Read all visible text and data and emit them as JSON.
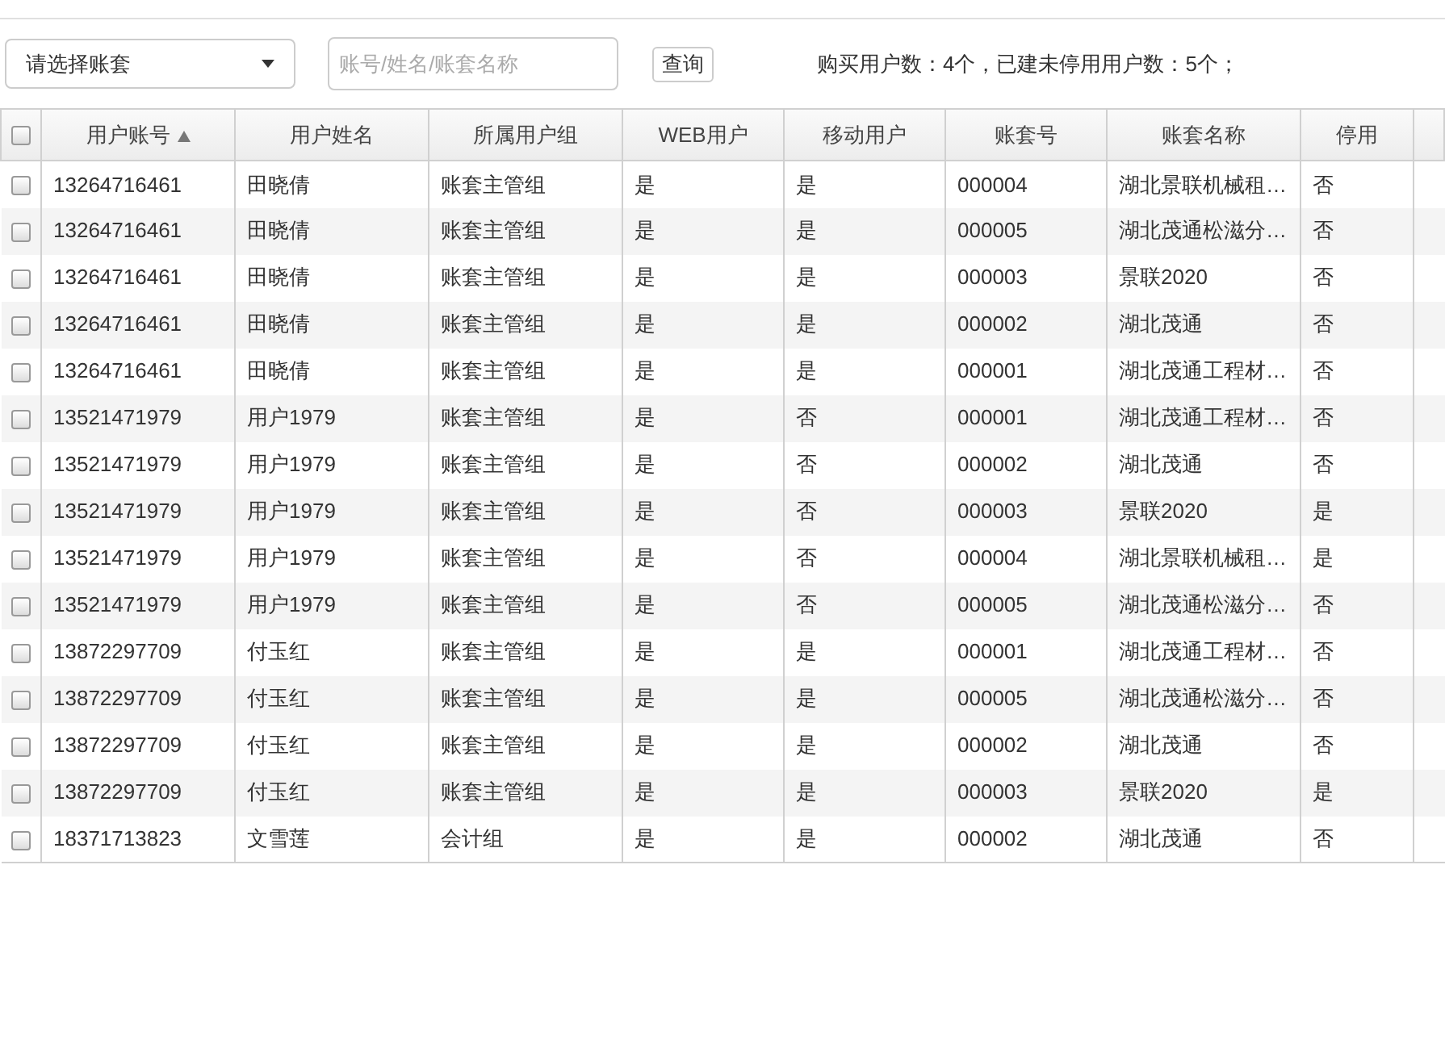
{
  "toolbar": {
    "account_select": {
      "value": "请选择账套"
    },
    "search": {
      "placeholder": "账号/姓名/账套名称"
    },
    "query_button": "查询",
    "summary": "购买用户数：4个，已建未停用用户数：5个；"
  },
  "table": {
    "select_all": {
      "checked": false
    },
    "columns": [
      {
        "label": "用户账号",
        "sorted": true
      },
      {
        "label": "用户姓名",
        "sorted": false
      },
      {
        "label": "所属用户组",
        "sorted": false
      },
      {
        "label": "WEB用户",
        "sorted": false
      },
      {
        "label": "移动用户",
        "sorted": false
      },
      {
        "label": "账套号",
        "sorted": false
      },
      {
        "label": "账套名称",
        "sorted": false
      },
      {
        "label": "停用",
        "sorted": false
      }
    ],
    "rows": [
      {
        "checked": false,
        "cells": [
          "13264716461",
          "田晓倩",
          "账套主管组",
          "是",
          "是",
          "000004",
          "湖北景联机械租…",
          "否"
        ]
      },
      {
        "checked": false,
        "cells": [
          "13264716461",
          "田晓倩",
          "账套主管组",
          "是",
          "是",
          "000005",
          "湖北茂通松滋分…",
          "否"
        ]
      },
      {
        "checked": false,
        "cells": [
          "13264716461",
          "田晓倩",
          "账套主管组",
          "是",
          "是",
          "000003",
          "景联2020",
          "否"
        ]
      },
      {
        "checked": false,
        "cells": [
          "13264716461",
          "田晓倩",
          "账套主管组",
          "是",
          "是",
          "000002",
          "湖北茂通",
          "否"
        ]
      },
      {
        "checked": false,
        "cells": [
          "13264716461",
          "田晓倩",
          "账套主管组",
          "是",
          "是",
          "000001",
          "湖北茂通工程材…",
          "否"
        ]
      },
      {
        "checked": false,
        "cells": [
          "13521471979",
          "用户1979",
          "账套主管组",
          "是",
          "否",
          "000001",
          "湖北茂通工程材…",
          "否"
        ]
      },
      {
        "checked": false,
        "cells": [
          "13521471979",
          "用户1979",
          "账套主管组",
          "是",
          "否",
          "000002",
          "湖北茂通",
          "否"
        ]
      },
      {
        "checked": false,
        "cells": [
          "13521471979",
          "用户1979",
          "账套主管组",
          "是",
          "否",
          "000003",
          "景联2020",
          "是"
        ]
      },
      {
        "checked": false,
        "cells": [
          "13521471979",
          "用户1979",
          "账套主管组",
          "是",
          "否",
          "000004",
          "湖北景联机械租…",
          "是"
        ]
      },
      {
        "checked": false,
        "cells": [
          "13521471979",
          "用户1979",
          "账套主管组",
          "是",
          "否",
          "000005",
          "湖北茂通松滋分…",
          "否"
        ]
      },
      {
        "checked": false,
        "cells": [
          "13872297709",
          "付玉红",
          "账套主管组",
          "是",
          "是",
          "000001",
          "湖北茂通工程材…",
          "否"
        ]
      },
      {
        "checked": false,
        "cells": [
          "13872297709",
          "付玉红",
          "账套主管组",
          "是",
          "是",
          "000005",
          "湖北茂通松滋分…",
          "否"
        ]
      },
      {
        "checked": false,
        "cells": [
          "13872297709",
          "付玉红",
          "账套主管组",
          "是",
          "是",
          "000002",
          "湖北茂通",
          "否"
        ]
      },
      {
        "checked": false,
        "cells": [
          "13872297709",
          "付玉红",
          "账套主管组",
          "是",
          "是",
          "000003",
          "景联2020",
          "是"
        ]
      },
      {
        "checked": false,
        "cells": [
          "18371713823",
          "文雪莲",
          "会计组",
          "是",
          "是",
          "000002",
          "湖北茂通",
          "否"
        ]
      }
    ]
  }
}
